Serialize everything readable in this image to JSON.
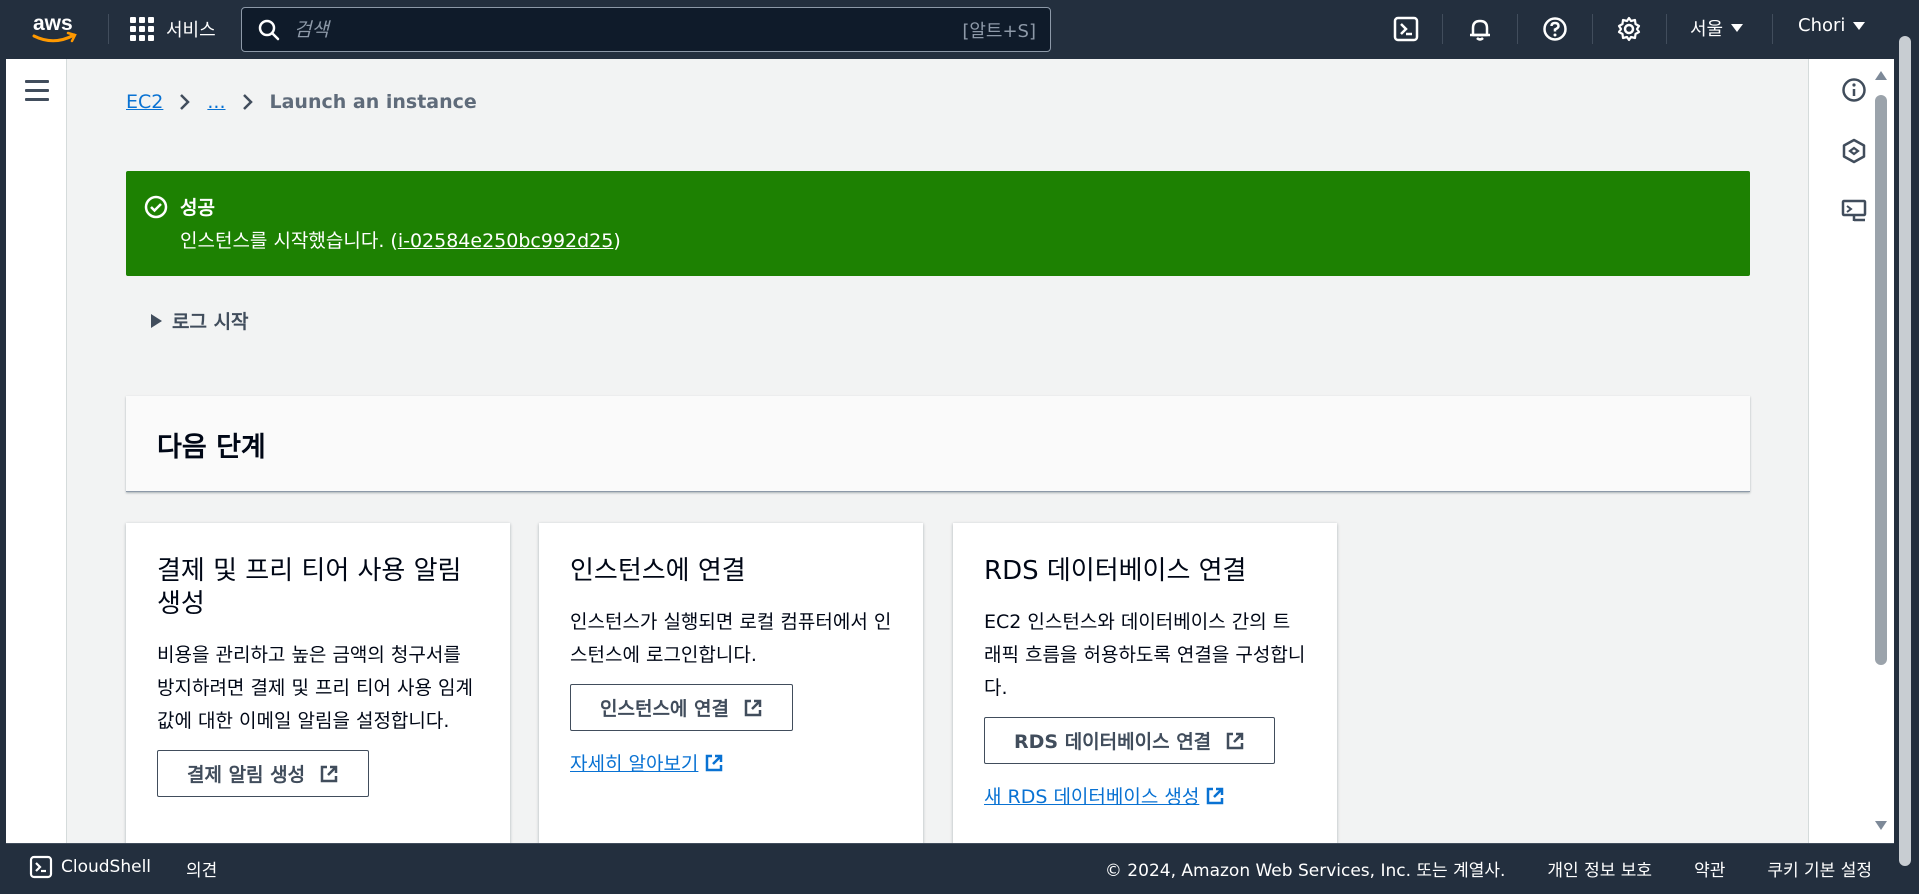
{
  "topnav": {
    "logo_text": "aws",
    "services_label": "서비스",
    "search_placeholder": "검색",
    "search_shortcut": "[알트+S]",
    "region_label": "서울",
    "user_label": "Chori"
  },
  "breadcrumb": {
    "root": "EC2",
    "ellipsis": "...",
    "current": "Launch an instance"
  },
  "flash": {
    "status": "success",
    "title": "성공",
    "message_prefix": "인스턴스를 시작했습니다. (",
    "instance_id": "i-02584e250bc992d25",
    "message_suffix": ")"
  },
  "expander": {
    "label": "로그 시작"
  },
  "next_steps": {
    "title": "다음 단계",
    "cards": [
      {
        "title": "결제 및 프리 티어 사용 알림 생성",
        "description": "비용을 관리하고 높은 금액의 청구서를 방지하려면 결제 및 프리 티어 사용 임계값에 대한 이메일 알림을 설정합니다.",
        "button": "결제 알림 생성",
        "link": ""
      },
      {
        "title": "인스턴스에 연결",
        "description": "인스턴스가 실행되면 로컬 컴퓨터에서 인스턴스에 로그인합니다.",
        "button": "인스턴스에 연결",
        "link": "자세히 알아보기"
      },
      {
        "title": "RDS 데이터베이스 연결",
        "description": "EC2 인스턴스와 데이터베이스 간의 트래픽 흐름을 허용하도록 연결을 구성합니다.",
        "button": "RDS 데이터베이스 연결",
        "link": "새 RDS 데이터베이스 생성"
      }
    ]
  },
  "footer": {
    "cloudshell": "CloudShell",
    "feedback": "의견",
    "copyright": "© 2024, Amazon Web Services, Inc. 또는 계열사.",
    "privacy": "개인 정보 보호",
    "terms": "약관",
    "cookies": "쿠키 기본 설정"
  },
  "colors": {
    "nav_bg": "#232f3e",
    "success": "#1d8102",
    "link": "#0972d3",
    "page_bg": "#f2f3f3"
  },
  "icons": [
    "grid-icon",
    "search-icon",
    "terminal-icon",
    "bell-icon",
    "help-icon",
    "gear-icon",
    "info-icon",
    "hexagon-icon",
    "feedback-icon",
    "check-circle-icon",
    "external-link-icon"
  ]
}
